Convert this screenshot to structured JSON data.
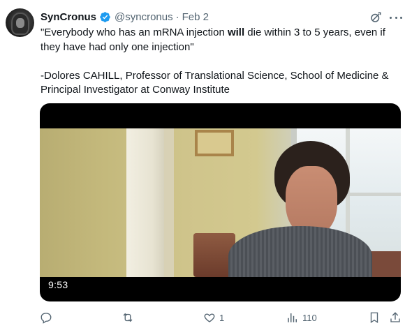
{
  "author": {
    "display_name": "SynCronus",
    "handle": "@syncronus",
    "separator": "·",
    "date": "Feb 2",
    "verified": true,
    "avatar_icon": "hooded-figure-avatar"
  },
  "tweet": {
    "line1_pre": "\"Everybody who has an mRNA injection ",
    "line1_bold": "will",
    "line1_post": " die within 3 to 5 years, even if",
    "line2": "they have had only one injection\"",
    "line3": "-Dolores CAHILL, Professor of Translational Science, School of Medicine &",
    "line4": "Principal Investigator at Conway Institute"
  },
  "video": {
    "duration": "9:53"
  },
  "actions": {
    "reply": {
      "icon": "reply-icon",
      "count": ""
    },
    "repost": {
      "icon": "repost-icon",
      "count": ""
    },
    "like": {
      "icon": "heart-icon",
      "count": "1"
    },
    "views": {
      "icon": "views-icon",
      "count": "110"
    },
    "bookmark": {
      "icon": "bookmark-icon",
      "count": ""
    },
    "share": {
      "icon": "share-icon",
      "count": ""
    }
  },
  "colors": {
    "text": "#0f1419",
    "muted": "#536471",
    "verified": "#1d9bf0"
  }
}
